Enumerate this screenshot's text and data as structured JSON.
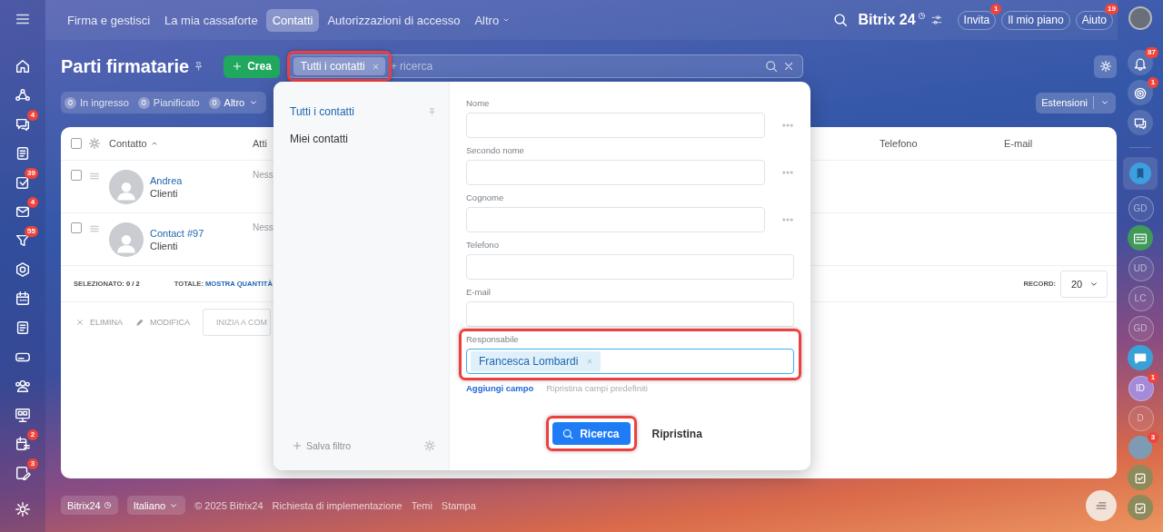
{
  "left_rail": {
    "items": [
      {
        "kind": "menu"
      },
      {
        "kind": "icon"
      },
      {
        "kind": "icon"
      },
      {
        "kind": "icon",
        "badge": "4"
      },
      {
        "kind": "icon"
      },
      {
        "kind": "icon",
        "badge": "39"
      },
      {
        "kind": "icon",
        "badge": "4"
      },
      {
        "kind": "icon",
        "badge": "55"
      },
      {
        "kind": "icon"
      },
      {
        "kind": "icon"
      },
      {
        "kind": "icon"
      },
      {
        "kind": "icon"
      },
      {
        "kind": "icon"
      },
      {
        "kind": "icon"
      },
      {
        "kind": "icon",
        "badge": "2"
      },
      {
        "kind": "icon",
        "badge": "3"
      },
      {
        "kind": "settings"
      }
    ]
  },
  "top_nav": {
    "tabs": [
      {
        "label": "Firma e gestisci",
        "selected": false,
        "kind": "link"
      },
      {
        "label": "La mia cassaforte",
        "selected": false,
        "kind": "link"
      },
      {
        "label": "Contatti",
        "selected": true,
        "kind": "link"
      },
      {
        "label": "Autorizzazioni di accesso",
        "selected": false,
        "kind": "link"
      },
      {
        "label": "Altro",
        "selected": false,
        "kind": "dropdown"
      }
    ]
  },
  "header": {
    "logo": "Bitrix 24",
    "buttons": [
      {
        "label": "Invita",
        "badge": "1"
      },
      {
        "label": "Il mio piano"
      },
      {
        "label": "Aiuto",
        "badge": "19"
      }
    ]
  },
  "page": {
    "title": "Parti firmatarie",
    "create_button": "Crea",
    "filter": {
      "chip": {
        "label": "Tutti i contatti",
        "highlighted": true
      },
      "placeholder": "+ ricerca"
    },
    "counters": [
      {
        "count": "0",
        "label": "In ingresso",
        "kind": "counter"
      },
      {
        "count": "0",
        "label": "Pianificato",
        "kind": "counter"
      },
      {
        "count": "0",
        "label": "Altro",
        "kind": "dropdown"
      }
    ],
    "extensions_button": "Estensioni"
  },
  "table": {
    "select_all": {
      "checked": false
    },
    "columns": [
      {
        "label": "Contatto",
        "sorted": true
      },
      {
        "label": "Atti",
        "sorted": false
      },
      {
        "label": "Telefono",
        "sorted": false
      },
      {
        "label": "E-mail",
        "sorted": false
      }
    ],
    "rows": [
      {
        "name": "Andrea",
        "type": "Clienti",
        "activity": "Ness",
        "checked": false
      },
      {
        "name": "Contact #97",
        "type": "Clienti",
        "activity": "Ness",
        "checked": false
      }
    ],
    "footer": {
      "selected_label": "SELEZIONATO:",
      "selected_value": "0 / 2",
      "total_label": "TOTALE:",
      "total_link": "MOSTRA QUANTITÀ",
      "records_label": "RECORD:",
      "records_value": "20"
    },
    "actions": [
      {
        "label": "ELIMINA",
        "kind": "delete"
      },
      {
        "label": "MODIFICA",
        "kind": "edit"
      }
    ],
    "action_field": "INIZIA A COM"
  },
  "filter_popup": {
    "presets": [
      {
        "label": "Tutti i contatti",
        "selected": true,
        "pinned": true
      },
      {
        "label": "Miei contatti",
        "selected": false,
        "pinned": false
      }
    ],
    "save_filter": "Salva filtro",
    "fields": [
      {
        "label": "Nome",
        "kind": "text",
        "menu": true,
        "highlighted": false
      },
      {
        "label": "Secondo nome",
        "kind": "text",
        "menu": true,
        "highlighted": false
      },
      {
        "label": "Cognome",
        "kind": "text",
        "menu": true,
        "highlighted": false
      },
      {
        "label": "Telefono",
        "kind": "text",
        "menu": false,
        "highlighted": false
      },
      {
        "label": "E-mail",
        "kind": "text",
        "menu": false,
        "highlighted": false
      },
      {
        "label": "Responsabile",
        "kind": "person",
        "value": "Francesca Lombardi",
        "menu": false,
        "highlighted": true
      }
    ],
    "add_field": "Aggiungi campo",
    "reset_fields": "Ripristina campi predefiniti",
    "search_button": {
      "label": "Ricerca",
      "highlighted": true
    },
    "reset_button": "Ripristina"
  },
  "footer": {
    "brand": "Bitrix24",
    "language": "Italiano",
    "copyright": "© 2025 Bitrix24",
    "links": [
      "Richiesta di implementazione",
      "Temi",
      "Stampa"
    ]
  },
  "right_rail": {
    "items": [
      {
        "kind": "icon",
        "badge": "87"
      },
      {
        "kind": "icon",
        "badge": "1"
      },
      {
        "kind": "icon"
      },
      {
        "kind": "bookmark"
      },
      {
        "kind": "initials",
        "initials": "GD"
      },
      {
        "kind": "icon"
      },
      {
        "kind": "initials",
        "initials": "UD"
      },
      {
        "kind": "initials",
        "initials": "LC"
      },
      {
        "kind": "initials",
        "initials": "GD"
      },
      {
        "kind": "icon"
      },
      {
        "kind": "initials",
        "initials": "ID",
        "badge": "1"
      },
      {
        "kind": "initials",
        "initials": "D"
      },
      {
        "kind": "photo",
        "badge": "3"
      },
      {
        "kind": "icon"
      },
      {
        "kind": "icon"
      }
    ]
  }
}
